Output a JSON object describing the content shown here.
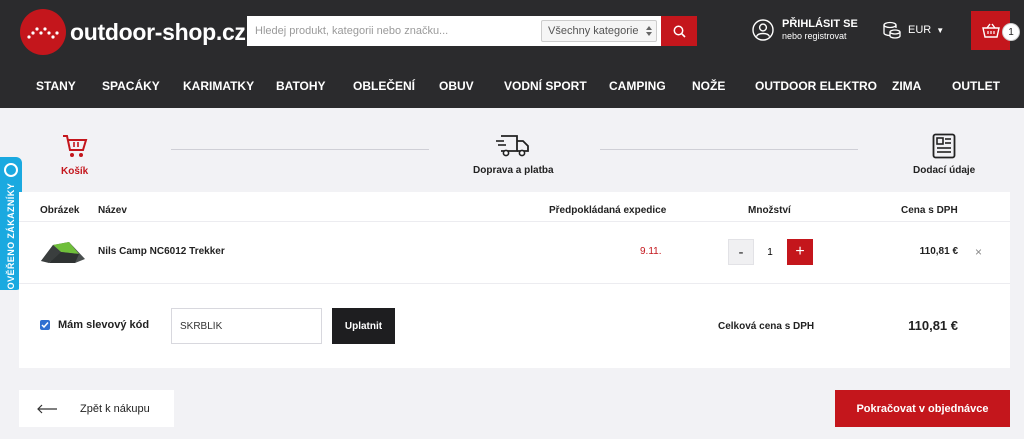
{
  "header": {
    "logo_text": "outdoor-shop.cz",
    "search_placeholder": "Hledej produkt, kategorii nebo značku...",
    "category_select": "Všechny kategorie",
    "login_title": "PŘIHLÁSIT SE",
    "login_sub": "nebo registrovat",
    "currency": "EUR",
    "cart_count": "1",
    "icons": [
      "logo-icon",
      "search-icon",
      "user-icon",
      "coins-icon",
      "basket-icon"
    ]
  },
  "nav": [
    "STANY",
    "SPACÁKY",
    "KARIMATKY",
    "BATOHY",
    "OBLEČENÍ",
    "OBUV",
    "VODNÍ SPORT",
    "CAMPING",
    "NOŽE",
    "OUTDOOR ELEKTRO",
    "ZIMA",
    "OUTLET"
  ],
  "side_badge": "OVĚŘENO ZÁKAZNÍKY",
  "steps": [
    {
      "label": "Košík",
      "icon": "basket-icon",
      "active": true
    },
    {
      "label": "Doprava a platba",
      "icon": "truck-icon",
      "active": false
    },
    {
      "label": "Dodací údaje",
      "icon": "form-icon",
      "active": false
    }
  ],
  "colors": {
    "brand": "#c4161c",
    "dark": "#2b2b2d",
    "badge": "#1aa9e0"
  },
  "cart": {
    "headers": {
      "image": "Obrázek",
      "name": "Název",
      "expedition": "Předpokládaná expedice",
      "quantity": "Množství",
      "price": "Cena s DPH"
    },
    "items": [
      {
        "name": "Nils Camp NC6012 Trekker",
        "expedition": "9.11.",
        "quantity": "1",
        "price": "110,81 €"
      }
    ],
    "minus": "-",
    "plus": "+",
    "remove": "×",
    "discount_label": "Mám slevový kód",
    "discount_value": "SKRBLÍK",
    "apply": "Uplatnit",
    "total_label": "Celková cena s DPH",
    "total_value": "110,81 €"
  },
  "footer": {
    "back": "Zpět k nákupu",
    "continue": "Pokračovat v objednávce"
  }
}
